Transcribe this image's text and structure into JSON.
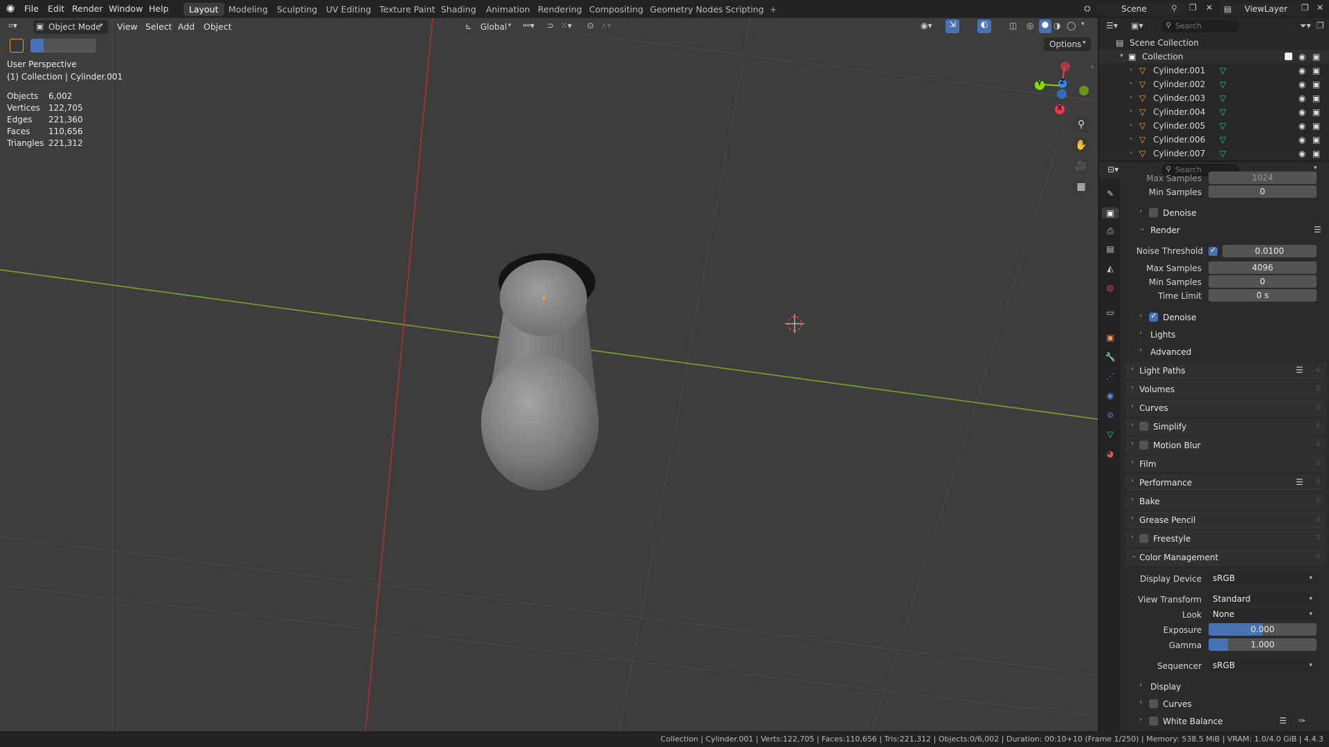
{
  "topbar": {
    "menus": [
      "File",
      "Edit",
      "Render",
      "Window",
      "Help"
    ],
    "workspaces": [
      "Layout",
      "Modeling",
      "Sculpting",
      "UV Editing",
      "Texture Paint",
      "Shading",
      "Animation",
      "Rendering",
      "Compositing",
      "Geometry Nodes",
      "Scripting"
    ],
    "active_workspace": "Layout",
    "add_tab": "+",
    "scene": "Scene",
    "view_layer": "ViewLayer"
  },
  "viewport_header": {
    "mode": "Object Mode",
    "menus": [
      "View",
      "Select",
      "Add",
      "Object"
    ],
    "orientation": "Global",
    "options": "Options"
  },
  "overlay": {
    "view_name": "User Perspective",
    "collection_info": "(1) Collection | Cylinder.001",
    "stats": [
      {
        "label": "Objects",
        "value": "6,002"
      },
      {
        "label": "Vertices",
        "value": "122,705"
      },
      {
        "label": "Edges",
        "value": "221,360"
      },
      {
        "label": "Faces",
        "value": "110,656"
      },
      {
        "label": "Triangles",
        "value": "221,312"
      }
    ]
  },
  "gizmo": {
    "x": "X",
    "y": "Y",
    "z": "Z"
  },
  "outliner": {
    "search_placeholder": "Search",
    "scene_collection": "Scene Collection",
    "collection": "Collection",
    "objects": [
      "Cylinder.001",
      "Cylinder.002",
      "Cylinder.003",
      "Cylinder.004",
      "Cylinder.005",
      "Cylinder.006",
      "Cylinder.007"
    ]
  },
  "properties": {
    "search_placeholder": "Search",
    "top_cut_label": "Max Samples",
    "top_cut_value": "1024",
    "viewport_min_samples_label": "Min Samples",
    "viewport_min_samples": "0",
    "viewport_denoise": "Denoise",
    "render_panel": "Render",
    "noise_threshold_label": "Noise Threshold",
    "noise_threshold": "0.0100",
    "max_samples_label": "Max Samples",
    "max_samples": "4096",
    "min_samples_label": "Min Samples",
    "min_samples": "0",
    "time_limit_label": "Time Limit",
    "time_limit": "0 s",
    "render_denoise": "Denoise",
    "lights": "Lights",
    "advanced": "Advanced",
    "panels": [
      "Light Paths",
      "Volumes",
      "Curves",
      "Simplify",
      "Motion Blur",
      "Film",
      "Performance",
      "Bake",
      "Grease Pencil",
      "Freestyle"
    ],
    "color_management": "Color Management",
    "display_device_label": "Display Device",
    "display_device": "sRGB",
    "view_transform_label": "View Transform",
    "view_transform": "Standard",
    "look_label": "Look",
    "look": "None",
    "exposure_label": "Exposure",
    "exposure": "0.000",
    "gamma_label": "Gamma",
    "gamma": "1.000",
    "sequencer_label": "Sequencer",
    "sequencer": "sRGB",
    "sub_display": "Display",
    "sub_curves": "Curves",
    "sub_white_balance": "White Balance"
  },
  "statusbar": {
    "text": "Collection | Cylinder.001 | Verts:122,705 | Faces:110,656 | Tris:221,312 | Objects:0/6,002 | Duration: 00:10+10 (Frame 1/250) | Memory: 538.5 MiB | VRAM: 1.0/4.0 GiB | 4.4.3"
  },
  "colors": {
    "accent_blue": "#4772b3",
    "x_axis": "#ff3352",
    "y_axis": "#8bdc00",
    "z_axis": "#2890ff"
  }
}
